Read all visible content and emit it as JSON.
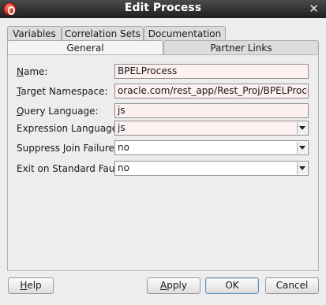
{
  "window": {
    "title": "Edit Process",
    "close_glyph": "✕"
  },
  "tabs_row1": [
    {
      "label": "Variables"
    },
    {
      "label": "Correlation Sets"
    },
    {
      "label": "Documentation"
    }
  ],
  "tabs_row2": [
    {
      "label": "General",
      "selected": true
    },
    {
      "label": "Partner Links",
      "selected": false
    }
  ],
  "form": {
    "name": {
      "label": "Name:",
      "value": "BPELProcess"
    },
    "target_namespace": {
      "label": "Target Namespace:",
      "value": "oracle.com/rest_app/Rest_Proj/BPELProcess"
    },
    "query_language": {
      "label": "Query Language:",
      "value": "js"
    },
    "expression_language": {
      "label": "Expression Language:",
      "value": "js"
    },
    "suppress_join_failure": {
      "label": "Suppress Join Failure:",
      "value": "no"
    },
    "exit_on_standard_fault": {
      "label": "Exit on Standard Fault:",
      "value": "no"
    }
  },
  "buttons": {
    "help": "Help",
    "apply": "Apply",
    "ok": "OK",
    "cancel": "Cancel"
  },
  "icons": {
    "app": "oracle-soa-logo-icon",
    "close": "close-icon",
    "dropdown": "chevron-down-icon"
  }
}
